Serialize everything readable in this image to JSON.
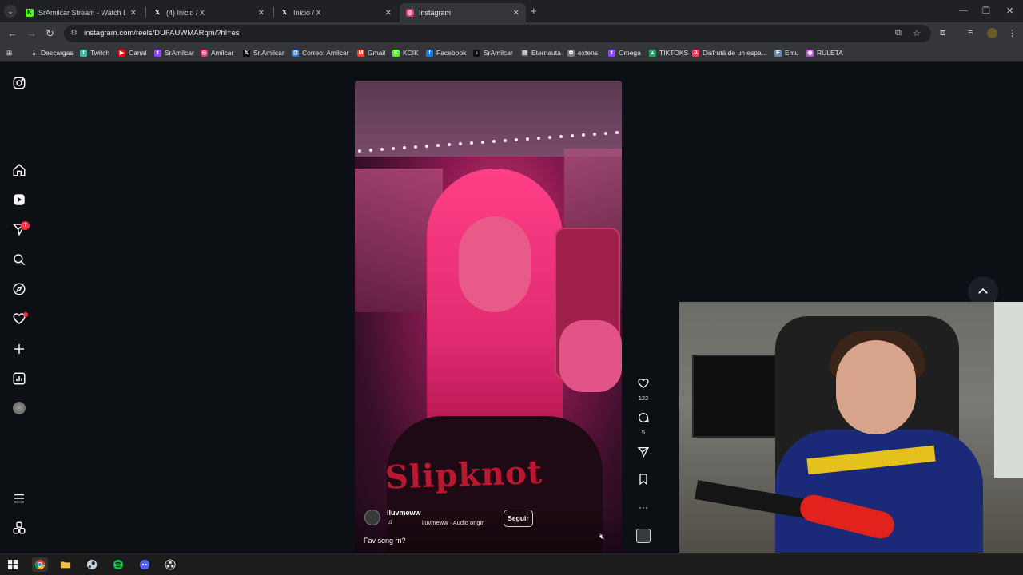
{
  "browser": {
    "tabs": [
      {
        "title": "SrAmilcar Stream - Watch Live o",
        "icon": "kick-icon",
        "color": "#53fc18",
        "glyph": "K"
      },
      {
        "title": "(4) Inicio / X",
        "icon": "x-icon",
        "color": "#202124",
        "glyph": "𝕏"
      },
      {
        "title": "Inicio / X",
        "icon": "x-icon",
        "color": "#202124",
        "glyph": "𝕏"
      },
      {
        "title": "Instagram",
        "icon": "instagram-icon",
        "color": "#e1306c",
        "glyph": "◎"
      }
    ],
    "url": "instagram.com/reels/DUFAUWMARqm/?hl=es",
    "bookmarks": [
      {
        "label": "Descargas",
        "icon": "download-icon",
        "color": "#35363a",
        "glyph": "⤓"
      },
      {
        "label": "Twitch",
        "icon": "twitch-icon",
        "color": "#3cb9a8",
        "glyph": "t"
      },
      {
        "label": "Canal",
        "icon": "youtube-icon",
        "color": "#ff0000",
        "glyph": "▶"
      },
      {
        "label": "SrAmilcar",
        "icon": "twitch-icon",
        "color": "#9146ff",
        "glyph": "t"
      },
      {
        "label": "Amilcar",
        "icon": "instagram-icon",
        "color": "#e1306c",
        "glyph": "◎"
      },
      {
        "label": "Sr.Amilcar",
        "icon": "x-icon",
        "color": "#000000",
        "glyph": "𝕏"
      },
      {
        "label": "Correo: Amilcar",
        "icon": "mail-icon",
        "color": "#2f7de1",
        "glyph": "@"
      },
      {
        "label": "Gmail",
        "icon": "gmail-icon",
        "color": "#ea4335",
        "glyph": "M"
      },
      {
        "label": "KCIK",
        "icon": "kick-icon",
        "color": "#53fc18",
        "glyph": "K"
      },
      {
        "label": "Facebook",
        "icon": "facebook-icon",
        "color": "#1877f2",
        "glyph": "f"
      },
      {
        "label": "SrAmilcar",
        "icon": "tiktok-icon",
        "color": "#111111",
        "glyph": "♪"
      },
      {
        "label": "Eternauta",
        "icon": "page-icon",
        "color": "#555555",
        "glyph": "▤"
      },
      {
        "label": "extens",
        "icon": "extension-icon",
        "color": "#777777",
        "glyph": "✿"
      },
      {
        "label": "Omega",
        "icon": "twitch-icon",
        "color": "#9146ff",
        "glyph": "t"
      },
      {
        "label": "TIKTOKS",
        "icon": "drive-icon",
        "color": "#1fa463",
        "glyph": "▲"
      },
      {
        "label": "Disfrutá de un espa...",
        "icon": "airbnb-icon",
        "color": "#ff385c",
        "glyph": "A"
      },
      {
        "label": "Emu",
        "icon": "emu-icon",
        "color": "#6a8caf",
        "glyph": "E"
      },
      {
        "label": "RULETA",
        "icon": "wheel-icon",
        "color": "#c04fd8",
        "glyph": "◉"
      }
    ]
  },
  "instagram": {
    "notification_count": "7"
  },
  "reel": {
    "username": "iluvmeww",
    "audio": "iluvmeww · Audio origin",
    "follow_label": "Seguir",
    "caption": "Fav song rn?",
    "likes": "122",
    "comments": "5",
    "overlay_text": "Slipknot"
  }
}
